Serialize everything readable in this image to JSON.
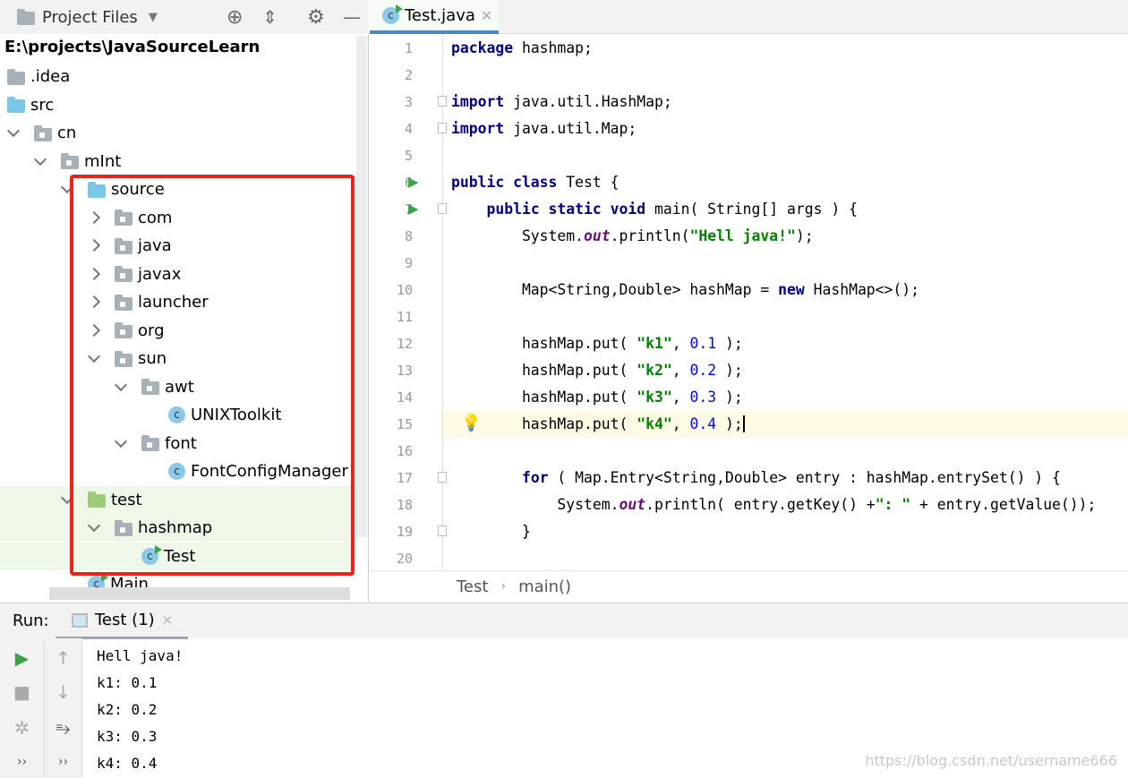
{
  "project": {
    "title": "Project Files",
    "root": "E:\\projects\\JavaSourceLearn",
    "tree": [
      {
        "label": ".idea",
        "level": 0,
        "icon": "folder-gray",
        "arrow": null
      },
      {
        "label": "src",
        "level": 0,
        "icon": "folder-blue",
        "arrow": null
      },
      {
        "label": "cn",
        "level": 1,
        "icon": "package",
        "arrow": "down"
      },
      {
        "label": "mInt",
        "level": 2,
        "icon": "package",
        "arrow": "down"
      },
      {
        "label": "source",
        "level": 3,
        "icon": "folder-blue",
        "arrow": "down"
      },
      {
        "label": "com",
        "level": 4,
        "icon": "package",
        "arrow": "right"
      },
      {
        "label": "java",
        "level": 4,
        "icon": "package",
        "arrow": "right"
      },
      {
        "label": "javax",
        "level": 4,
        "icon": "package",
        "arrow": "right"
      },
      {
        "label": "launcher",
        "level": 4,
        "icon": "package",
        "arrow": "right"
      },
      {
        "label": "org",
        "level": 4,
        "icon": "package",
        "arrow": "right"
      },
      {
        "label": "sun",
        "level": 4,
        "icon": "package",
        "arrow": "down"
      },
      {
        "label": "awt",
        "level": 5,
        "icon": "package",
        "arrow": "down"
      },
      {
        "label": "UNIXToolkit",
        "level": 6,
        "icon": "class",
        "arrow": null
      },
      {
        "label": "font",
        "level": 5,
        "icon": "package",
        "arrow": "down"
      },
      {
        "label": "FontConfigManager",
        "level": 6,
        "icon": "class",
        "arrow": null
      },
      {
        "label": "test",
        "level": 3,
        "icon": "folder-green",
        "arrow": "down",
        "green": true
      },
      {
        "label": "hashmap",
        "level": 4,
        "icon": "package",
        "arrow": "down",
        "green": true
      },
      {
        "label": "Test",
        "level": 5,
        "icon": "class-run",
        "arrow": null,
        "green": true
      },
      {
        "label": "Main",
        "level": 3,
        "icon": "class-run",
        "arrow": null
      }
    ]
  },
  "editor": {
    "tab": "Test.java",
    "current_line": 15,
    "lines": [
      [
        [
          "kw",
          "package"
        ],
        [
          "p",
          " hashmap;"
        ]
      ],
      [],
      [
        [
          "kw",
          "import"
        ],
        [
          "p",
          " java.util.HashMap;"
        ]
      ],
      [
        [
          "kw",
          "import"
        ],
        [
          "p",
          " java.util.Map;"
        ]
      ],
      [],
      [
        [
          "kw",
          "public class"
        ],
        [
          "p",
          " Test {"
        ]
      ],
      [
        [
          "p",
          "    "
        ],
        [
          "kw",
          "public static void"
        ],
        [
          "p",
          " main( String[] args ) {"
        ]
      ],
      [
        [
          "p",
          "        System."
        ],
        [
          "field",
          "out"
        ],
        [
          "p",
          ".println("
        ],
        [
          "str",
          "\"Hell java!\""
        ],
        [
          "p",
          ");"
        ]
      ],
      [],
      [
        [
          "p",
          "        Map<String,Double> hashMap = "
        ],
        [
          "kw",
          "new"
        ],
        [
          "p",
          " HashMap<>();"
        ]
      ],
      [],
      [
        [
          "p",
          "        hashMap.put( "
        ],
        [
          "str",
          "\"k1\""
        ],
        [
          "p",
          ", "
        ],
        [
          "num",
          "0.1"
        ],
        [
          "p",
          " );"
        ]
      ],
      [
        [
          "p",
          "        hashMap.put( "
        ],
        [
          "str",
          "\"k2\""
        ],
        [
          "p",
          ", "
        ],
        [
          "num",
          "0.2"
        ],
        [
          "p",
          " );"
        ]
      ],
      [
        [
          "p",
          "        hashMap.put( "
        ],
        [
          "str",
          "\"k3\""
        ],
        [
          "p",
          ", "
        ],
        [
          "num",
          "0.3"
        ],
        [
          "p",
          " );"
        ]
      ],
      [
        [
          "p",
          "        hashMap.put( "
        ],
        [
          "str",
          "\"k4\""
        ],
        [
          "p",
          ", "
        ],
        [
          "num",
          "0.4"
        ],
        [
          "p",
          " );"
        ]
      ],
      [],
      [
        [
          "p",
          "        "
        ],
        [
          "kw",
          "for"
        ],
        [
          "p",
          " ( Map.Entry<String,Double> entry : hashMap.entrySet() ) {"
        ]
      ],
      [
        [
          "p",
          "            System."
        ],
        [
          "field",
          "out"
        ],
        [
          "p",
          ".println( entry.getKey() +"
        ],
        [
          "str",
          "\": \""
        ],
        [
          "p",
          " + entry.getValue());"
        ]
      ],
      [
        [
          "p",
          "        }"
        ]
      ],
      []
    ],
    "breadcrumb": [
      "Test",
      "main()"
    ]
  },
  "run": {
    "label": "Run:",
    "tab": "Test (1)",
    "output": [
      "Hell java!",
      "k1: 0.1",
      "k2: 0.2",
      "k3: 0.3",
      "k4: 0.4"
    ]
  },
  "watermark": "https://blog.csdn.net/username666",
  "colors": {
    "keyword": "#000080",
    "string": "#008000",
    "number": "#0000ff",
    "highlight_box": "#f0201a",
    "test_folder_bg": "#eff8e8"
  }
}
